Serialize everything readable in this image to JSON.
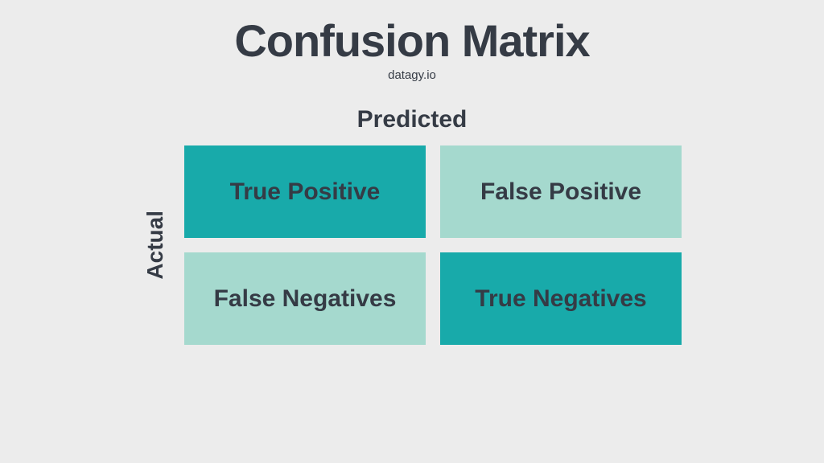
{
  "header": {
    "title": "Confusion Matrix",
    "subtitle": "datagy.io"
  },
  "axis_labels": {
    "predicted": "Predicted",
    "actual": "Actual"
  },
  "cells": {
    "top_left": "True Positive",
    "top_right": "False Positive",
    "bottom_left": "False Negatives",
    "bottom_right": "True Negatives"
  },
  "colors": {
    "background": "#ececec",
    "text": "#353b45",
    "cell_dark": "#18aaaa",
    "cell_light": "#a5d9ce"
  }
}
